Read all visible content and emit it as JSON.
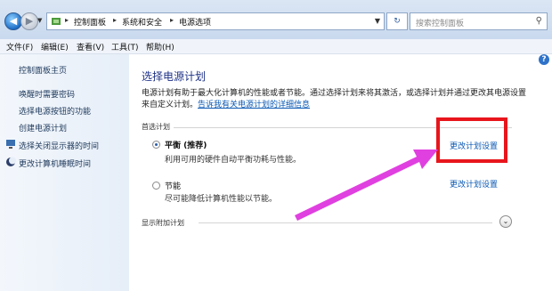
{
  "address_bar": {
    "breadcrumbs": [
      "控制面板",
      "系统和安全",
      "电源选项"
    ],
    "search_placeholder": "搜索控制面板"
  },
  "menu": [
    "文件(F)",
    "编辑(E)",
    "查看(V)",
    "工具(T)",
    "帮助(H)"
  ],
  "sidebar": {
    "items": [
      "控制面板主页",
      "唤醒时需要密码",
      "选择电源按钮的功能",
      "创建电源计划",
      "选择关闭显示器的时间",
      "更改计算机睡眠时间"
    ]
  },
  "main": {
    "title": "选择电源计划",
    "desc_line1": "电源计划有助于最大化计算机的性能或者节能。通过选择计划来将其激活，或选择计划并通过更改其电源设置",
    "desc_line2_prefix": "来自定义计划。",
    "desc_link": "告诉我有关电源计划的详细信息",
    "preferred_section": "首选计划",
    "plans": [
      {
        "name": "平衡 (推荐)",
        "description": "利用可用的硬件自动平衡功耗与性能。",
        "selected": true,
        "change_label": "更改计划设置"
      },
      {
        "name": "节能",
        "description": "尽可能降低计算机性能以节能。",
        "selected": false,
        "change_label": "更改计划设置"
      }
    ],
    "additional_section": "显示附加计划"
  },
  "colors": {
    "accent_link": "#0b59b4",
    "highlight_box": "#e8151c",
    "arrow": "#e040e0"
  }
}
